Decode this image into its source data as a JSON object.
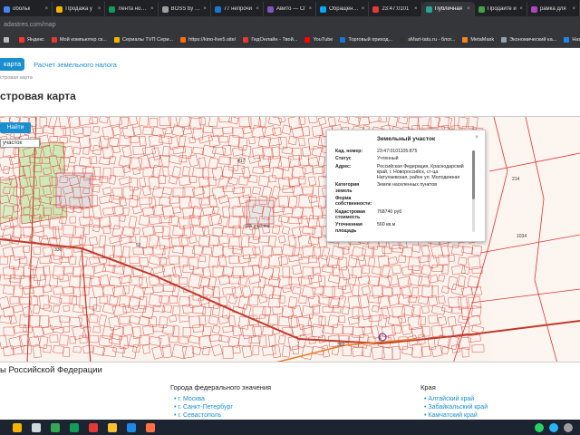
{
  "browser": {
    "tabs": [
      {
        "label": "обольк",
        "color": "#4285f4",
        "active": false
      },
      {
        "label": "Продажа у",
        "color": "#f4b400",
        "active": false
      },
      {
        "label": "Лента новос",
        "color": "#0f9d58",
        "active": false
      },
      {
        "label": "BOSS by Ver",
        "color": "#9e9e9e",
        "active": false
      },
      {
        "label": "77 непрочи",
        "color": "#1976d2",
        "active": false
      },
      {
        "label": "Авито — Сг",
        "color": "#7e57c2",
        "active": false
      },
      {
        "label": "Обращение",
        "color": "#03a9f4",
        "active": false
      },
      {
        "label": "23:47:0101",
        "color": "#e53935",
        "active": false
      },
      {
        "label": "Публичная",
        "color": "#26a69a",
        "active": true
      },
      {
        "label": "Продайте и",
        "color": "#43a047",
        "active": false
      },
      {
        "label": "рамка для",
        "color": "#ab47bc",
        "active": false
      }
    ],
    "close_glyph": "×",
    "url_host": "adastres.com",
    "url_path": "/map",
    "bookmarks": [
      {
        "label": "",
        "color": "#bbbbbb"
      },
      {
        "label": "Яндекс",
        "color": "#ff3333"
      },
      {
        "label": "Мой компьютер ск...",
        "color": "#e53935"
      },
      {
        "label": "Сериалы TVП Сери...",
        "color": "#f4b400"
      },
      {
        "label": "https://kino-live5.site/",
        "color": "#ff6d00"
      },
      {
        "label": "ГидОнлайн - Твой...",
        "color": "#e53935"
      },
      {
        "label": "YouTube",
        "color": "#ff0000"
      },
      {
        "label": "Торговый приход...",
        "color": "#1976d2"
      },
      {
        "label": "sMart-tatu.ru - блог...",
        "color": "#333333"
      },
      {
        "label": "MetaMask",
        "color": "#f6851b"
      },
      {
        "label": "Экономический ка...",
        "color": "#90a4ae"
      },
      {
        "label": "Наташа Н",
        "color": "#1e88e5"
      }
    ]
  },
  "page": {
    "nav_active": "карта",
    "nav_link": "Расчет земельного налога",
    "breadcrumb": "стровая карта",
    "title": "стровая карта"
  },
  "map": {
    "find_button": "Найти",
    "layer_select": "участок",
    "labels": [
      {
        "text": "417"
      },
      {
        "text": "330"
      },
      {
        "text": "52"
      },
      {
        "text": "235 участка"
      },
      {
        "text": "360"
      },
      {
        "text": "4"
      },
      {
        "text": "214"
      },
      {
        "text": "1034"
      }
    ]
  },
  "popup": {
    "title": "Земельный участок",
    "close": "×",
    "rows": [
      {
        "key": "Кад. номер:",
        "value": "23:47:0101105:875"
      },
      {
        "key": "Статус",
        "value": "Учтенный"
      },
      {
        "key": "Адрес:",
        "value": "Российская Федерация, Краснодарский край, г. Новороссийск, ст-ца Натухаевская, район ул. Молодежная"
      },
      {
        "key": "Категория земель",
        "value": "Земли населенных пунктов"
      },
      {
        "key": "Форма собственности:",
        "value": ""
      },
      {
        "key": "Кадастровая стоимость",
        "value": "768740 руб"
      },
      {
        "key": "Уточненная площадь",
        "value": "560 кв.м"
      }
    ]
  },
  "footer": {
    "section_title": "ы Российской Федерации",
    "cities_header": "Города федерального значения",
    "cities": [
      "г. Москва",
      "г. Санкт-Петербург",
      "г. Севастополь"
    ],
    "regions_header": "Края",
    "regions": [
      "Алтайский край",
      "Забайкальский край",
      "Камчатский край"
    ]
  },
  "taskbar": {
    "apps": [
      {
        "name": "copilot-icon",
        "color": "#f4b400"
      },
      {
        "name": "taskview-icon",
        "color": "#cfd8dc"
      },
      {
        "name": "chrome-icon",
        "color": "#34a853"
      },
      {
        "name": "edge-icon",
        "color": "#0f9d58"
      },
      {
        "name": "opera-icon",
        "color": "#e53935"
      },
      {
        "name": "folder-icon",
        "color": "#fbc02d"
      },
      {
        "name": "store-icon",
        "color": "#1e88e5"
      },
      {
        "name": "firefox-icon",
        "color": "#ff7043"
      }
    ],
    "tray": [
      {
        "name": "whatsapp-icon",
        "color": "#25d366"
      },
      {
        "name": "telegram-icon",
        "color": "#29b6f6"
      },
      {
        "name": "settings-icon",
        "color": "#9e9e9e"
      }
    ]
  }
}
